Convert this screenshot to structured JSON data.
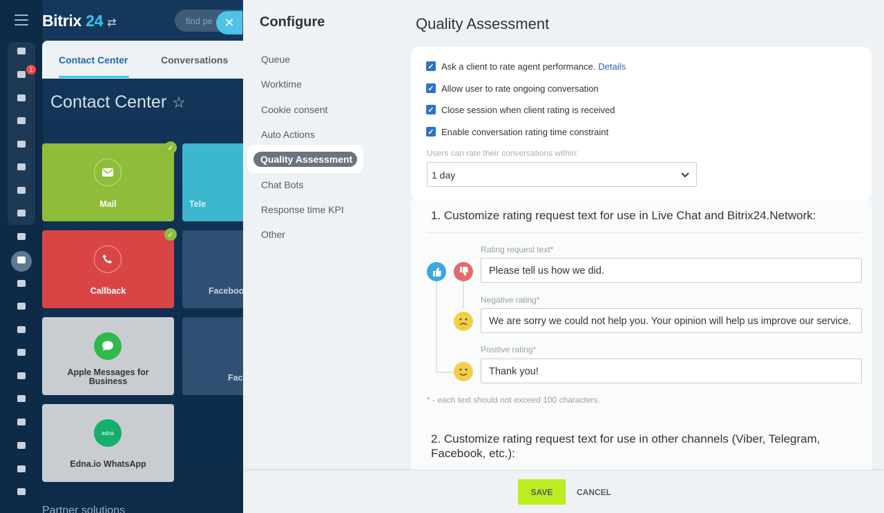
{
  "app": {
    "logo_text": "Bitrix",
    "logo_num": "24",
    "search_placeholder": "find pe"
  },
  "rail": {
    "notif_count": "1",
    "icons": [
      "grid-icon",
      "news-icon",
      "chat-icon",
      "calendar-icon",
      "docs-icon",
      "drive-icon",
      "mail-icon",
      "groups-icon",
      "tasks-icon",
      "crm-filter-icon",
      "store-icon",
      "target-icon",
      "cart-icon",
      "sign-icon",
      "esign-icon",
      "analytics-icon",
      "employees-icon",
      "robot-icon",
      "box-icon",
      "more-icon"
    ]
  },
  "background": {
    "tabs": [
      "Contact Center",
      "Conversations"
    ],
    "page_title": "Contact Center",
    "tiles": [
      {
        "label": "Mail",
        "color": "#8fbd3a"
      },
      {
        "label": "Tele",
        "color": "#3db6cf"
      },
      {
        "label": "Callback",
        "color": "#d94545"
      },
      {
        "label": "Faceboo",
        "color": "#2f4f73"
      },
      {
        "label": "Apple Messages for Business",
        "color": "#c9cdd2"
      },
      {
        "label": "Fac",
        "color": "#2f4f73"
      },
      {
        "label": "Edna.io WhatsApp",
        "color": "#c9cdd2"
      }
    ],
    "partner": "Partner solutions"
  },
  "configure": {
    "title": "Configure",
    "items": [
      "Queue",
      "Worktime",
      "Cookie consent",
      "Auto Actions",
      "Quality Assessment",
      "Chat Bots",
      "Response time KPI",
      "Other"
    ],
    "active": "Quality Assessment"
  },
  "main": {
    "title": "Quality Assessment",
    "checkboxes": [
      {
        "label": "Ask a client to rate agent performance.",
        "link": "Details",
        "checked": true
      },
      {
        "label": "Allow user to rate ongoing conversation",
        "checked": true
      },
      {
        "label": "Close session when client rating is received",
        "checked": true
      },
      {
        "label": "Enable conversation rating time constraint",
        "checked": true
      }
    ],
    "select_label": "Users can rate their conversations within:",
    "select_value": "1 day",
    "section1": "1. Customize rating request text for use in Live Chat and Bitrix24.Network:",
    "fields": [
      {
        "label": "Rating request text*",
        "value": "Please tell us how we did."
      },
      {
        "label": "Negative rating*",
        "value": "We are sorry we could not help you. Your opinion will help us improve our service."
      },
      {
        "label": "Positive rating*",
        "value": "Thank you!"
      }
    ],
    "note": "* - each text should not exceed 100 characters.",
    "section2": "2. Customize rating request text for use in other channels (Viber, Telegram, Facebook, etc.):"
  },
  "footer": {
    "save": "SAVE",
    "cancel": "CANCEL"
  }
}
